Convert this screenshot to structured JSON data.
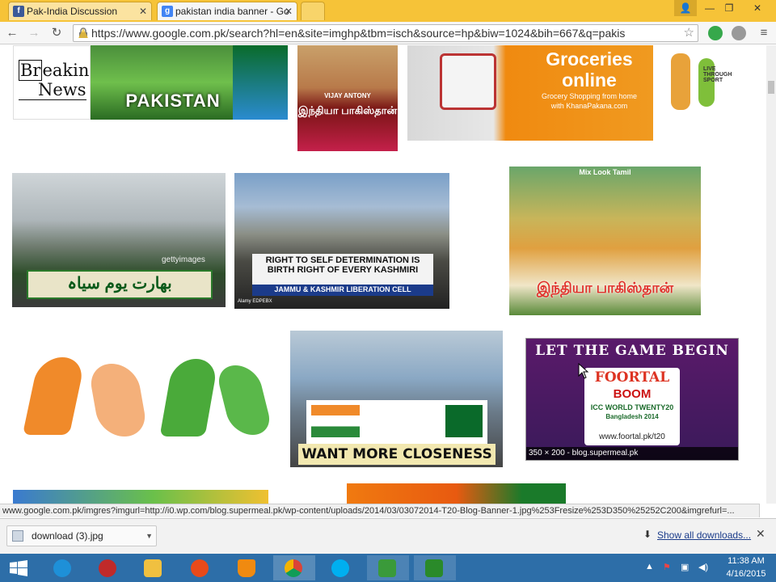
{
  "window": {
    "tabs": [
      {
        "label": "Pak-India Discussion",
        "icon": "facebook-icon",
        "color": "#3b5998",
        "active": false
      },
      {
        "label": "pakistan india banner - Go",
        "icon": "google-icon",
        "color": "#4285f4",
        "active": true
      }
    ]
  },
  "toolbar": {
    "url": "https://www.google.com.pk/search?hl=en&site=imghp&tbm=isch&source=hp&biw=1024&bih=667&q=pakis"
  },
  "results": {
    "breaking_news": {
      "line1": "Br",
      "line1b": "eaking",
      "line2": "News"
    },
    "pakistan_text": "PAKISTAN",
    "groceries": {
      "title": "Groceries online",
      "sub": "Grocery Shopping from home",
      "site": "with KhanaPakana.com"
    },
    "tamil_title_1": "இந்தியா பாகிஸ்தான்",
    "vijay_antony": "VIJAY ANTONY",
    "sport_text": "LIVE THROUGH SPORT",
    "getty": "gettyimages",
    "banner1": "بھارت یوم سیاہ",
    "kashmir_line1": "RIGHT TO SELF DETERMINATION IS",
    "kashmir_line2": "BIRTH RIGHT OF EVERY KASHMIRI",
    "kashmir_line3": "JAMMU & KASHMIR LIBERATION CELL",
    "alamy": "Alamy EDPEBX",
    "mixlook": "Mix Look Tamil",
    "tamil_title_2": "இந்தியா பாகிஸ்தான்",
    "closeness": "WANT MORE CLOSENESS",
    "game_begin": "LET THE GAME BEGIN",
    "foortal": "FOORTAL",
    "boom": "BOOM",
    "t20": "ICC WORLD TWENTY20",
    "bangladesh": "Bangladesh 2014",
    "foortal_url": "www.foortal.pk/t20",
    "hover_caption": "350 × 200 - blog.supermeal.pk"
  },
  "statusbar": {
    "text": "www.google.com.pk/imgres?imgurl=http://i0.wp.com/blog.supermeal.pk/wp-content/uploads/2014/03/03072014-T20-Blog-Banner-1.jpg%253Fresize%253D350%25252C200&imgrefurl=..."
  },
  "downloads": {
    "file": "download (3).jpg",
    "show_all": "Show all downloads..."
  },
  "taskbar": {
    "time": "11:38 AM",
    "date": "4/16/2015"
  },
  "colors": {
    "titlebar": "#f6c338",
    "taskbar": "#2d6ea8",
    "link": "#1a3b8a"
  }
}
